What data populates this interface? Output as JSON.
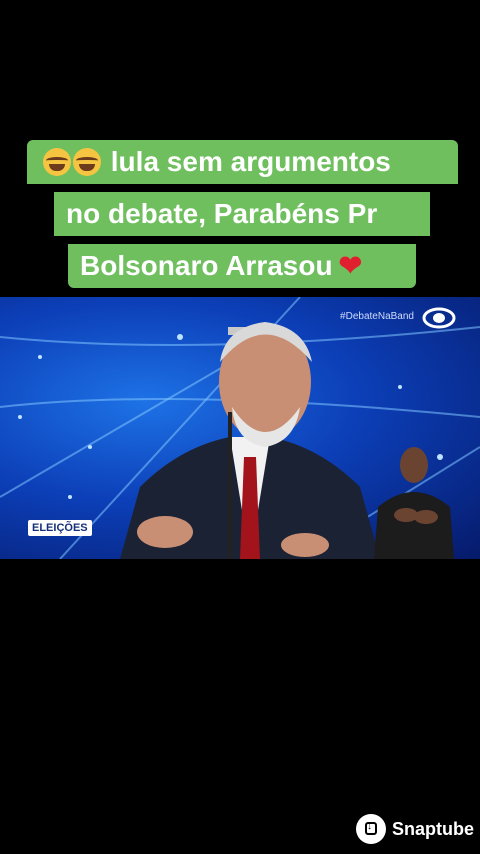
{
  "caption": {
    "line1": "lula sem argumentos",
    "line2": "no debate, Parabéns Pr",
    "line3": "Bolsonaro Arrasou",
    "emoji_icons": [
      "face-with-tears-of-joy-icon",
      "face-with-tears-of-joy-icon"
    ],
    "end_icon": "red-heart-icon",
    "heart_glyph": "❤",
    "background_color": "#6fbf5f"
  },
  "video": {
    "hashtag": "#DebateNaBand",
    "logo_icon": "band-logo-icon",
    "overlay_label": "ELEIÇÕES",
    "background_color": "#0c3fb8"
  },
  "watermark": {
    "label": "Snaptube",
    "icon": "snaptube-download-icon"
  }
}
